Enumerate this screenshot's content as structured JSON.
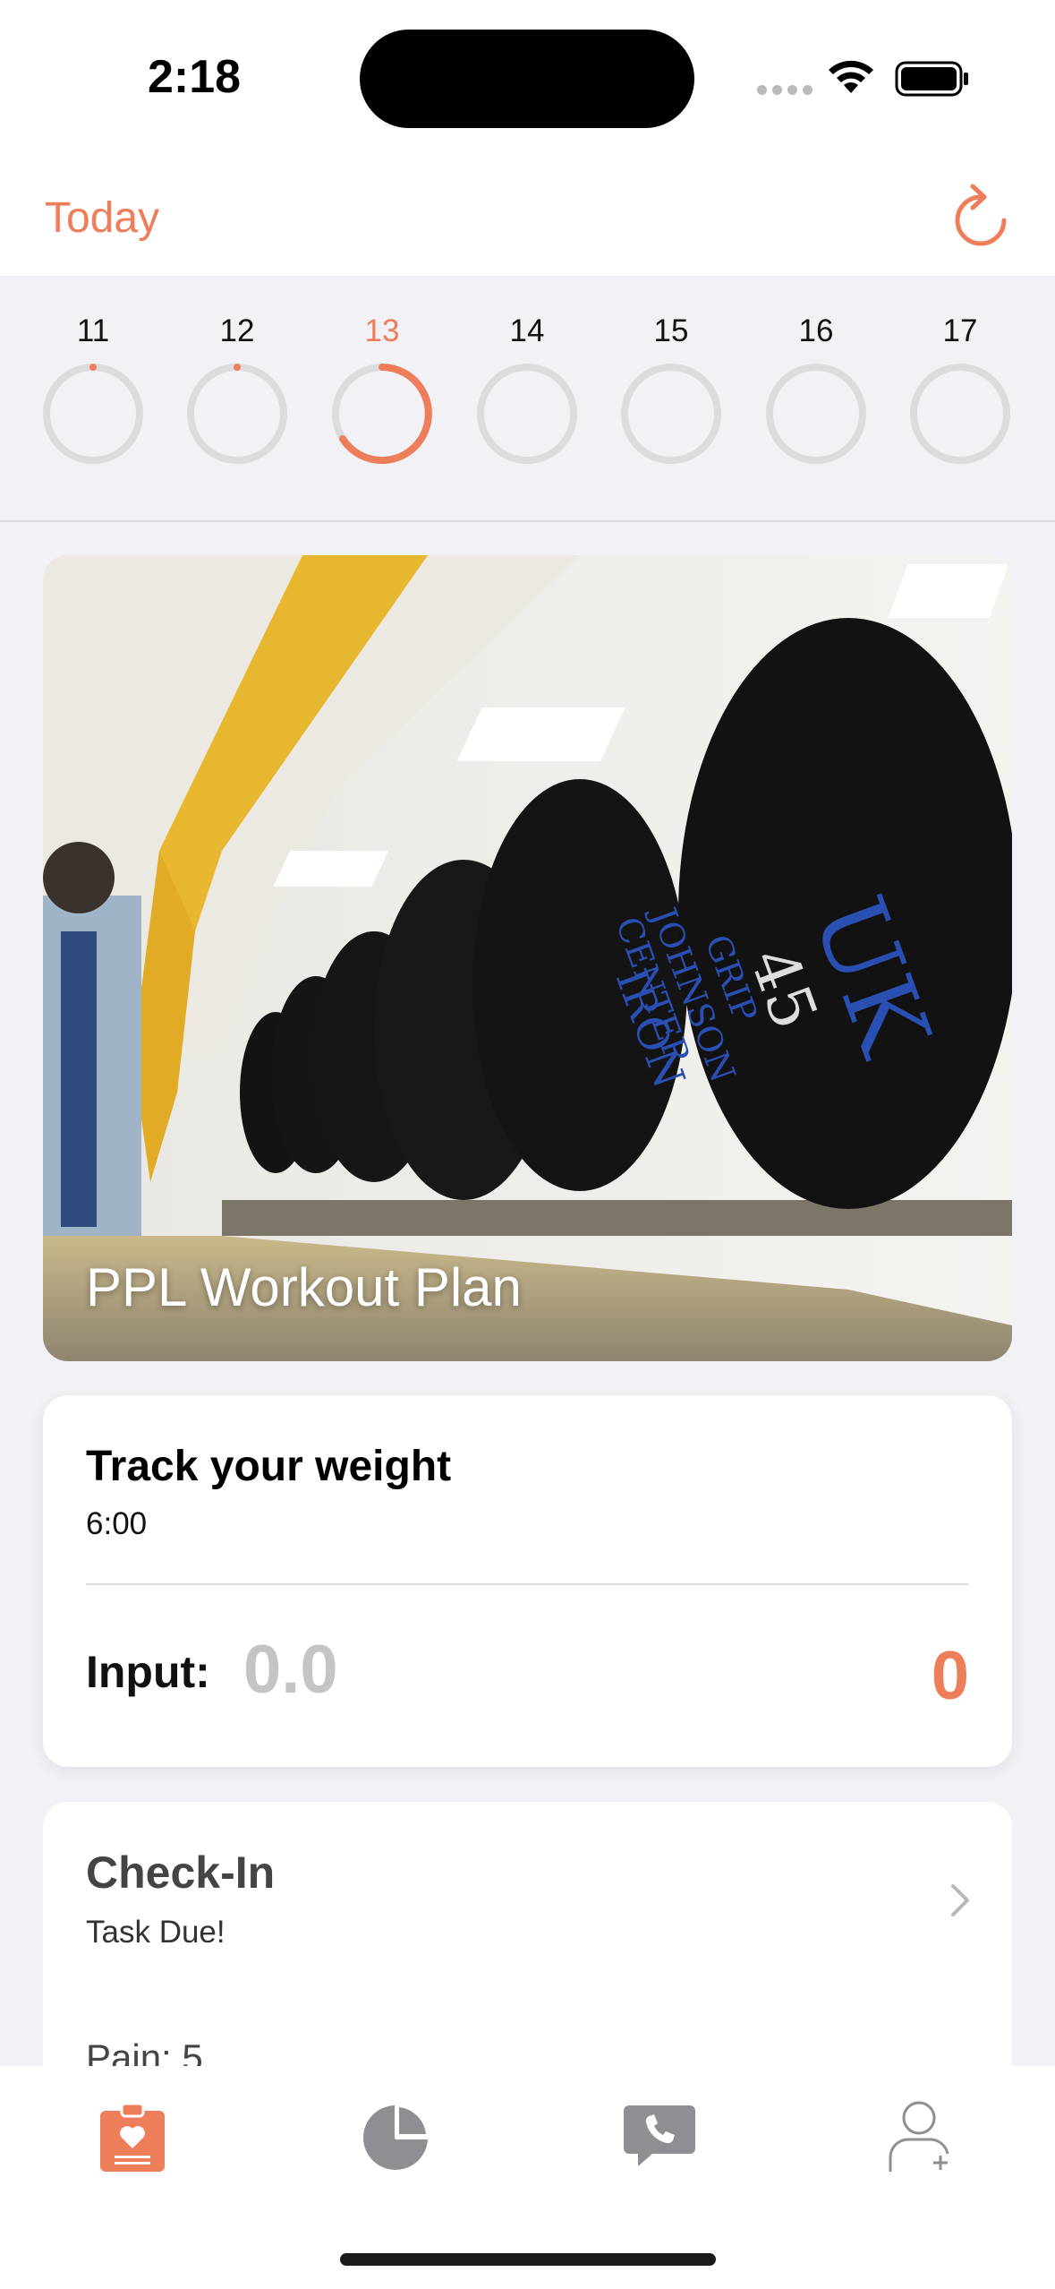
{
  "status_bar": {
    "time": "2:18"
  },
  "nav": {
    "title": "Today",
    "refresh_icon": "refresh-icon"
  },
  "week": {
    "days": [
      {
        "label": "11",
        "progress": 0.0,
        "today": false
      },
      {
        "label": "12",
        "progress": 0.0,
        "today": false
      },
      {
        "label": "13",
        "progress": 0.35,
        "today": true
      },
      {
        "label": "14",
        "progress": 0.0,
        "today": false
      },
      {
        "label": "15",
        "progress": 0.0,
        "today": false
      },
      {
        "label": "16",
        "progress": 0.0,
        "today": false
      },
      {
        "label": "17",
        "progress": 0.0,
        "today": false
      }
    ]
  },
  "plan_card": {
    "title": "PPL Workout Plan",
    "image": "dumbbell-rack-photo"
  },
  "weight_card": {
    "title": "Track your weight",
    "time": "6:00",
    "input_label": "Input:",
    "input_placeholder": "0.0",
    "value": "0"
  },
  "checkin_card": {
    "title": "Check-In",
    "status": "Task Due!",
    "pain_label": "Pain: 5"
  },
  "tabs": [
    {
      "name": "tab-care-plan",
      "icon": "clipboard-heart-icon",
      "active": true
    },
    {
      "name": "tab-insights",
      "icon": "pie-chart-icon",
      "active": false
    },
    {
      "name": "tab-contacts",
      "icon": "phone-bubble-icon",
      "active": false
    },
    {
      "name": "tab-profile",
      "icon": "person-add-icon",
      "active": false
    }
  ],
  "colors": {
    "accent": "#ee7d5a",
    "ring_bg": "#dcdcdf",
    "inactive_icon": "#8e8e93"
  }
}
